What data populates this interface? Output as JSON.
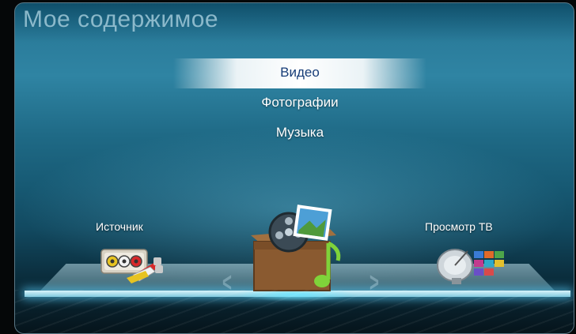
{
  "screen": {
    "title": "Мое содержимое"
  },
  "menu": {
    "items": [
      {
        "label": "Видео",
        "selected": true
      },
      {
        "label": "Фотографии",
        "selected": false
      },
      {
        "label": "Музыка",
        "selected": false
      }
    ]
  },
  "shelf": {
    "left_item": {
      "label": "Источник",
      "icon": "av-source-icon"
    },
    "center_item": {
      "icon": "media-box-icon"
    },
    "right_item": {
      "label": "Просмотр ТВ",
      "icon": "satellite-tv-icon"
    },
    "prev_arrow": "<",
    "next_arrow": ">"
  },
  "colors": {
    "accent_selected_text": "#173d78",
    "glow": "#6ee6ff"
  }
}
